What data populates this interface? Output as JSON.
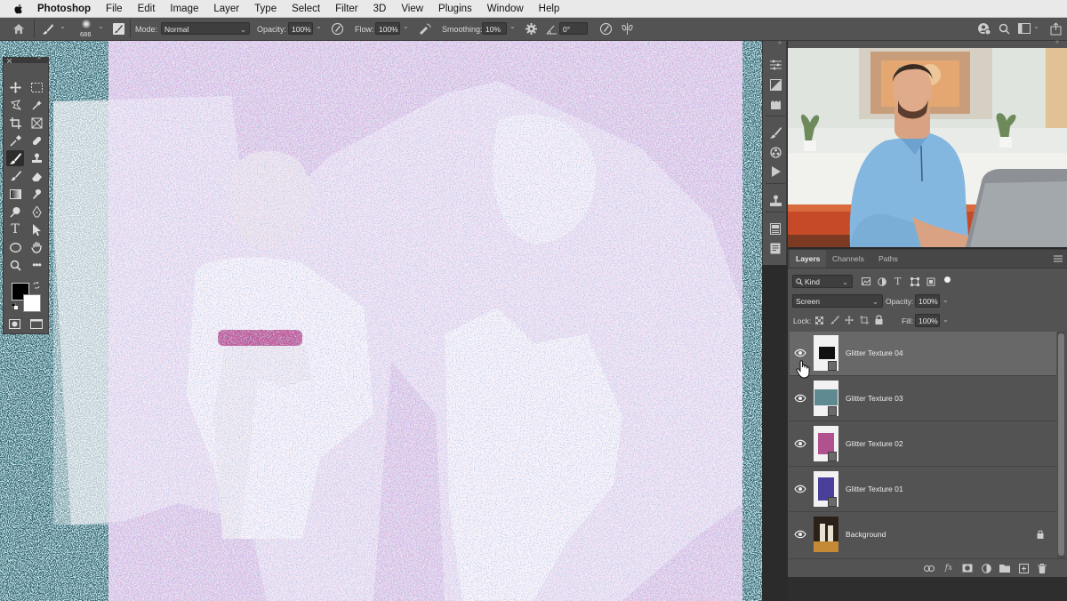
{
  "menubar": {
    "app_name": "Photoshop",
    "items": [
      "File",
      "Edit",
      "Image",
      "Layer",
      "Type",
      "Select",
      "Filter",
      "3D",
      "View",
      "Plugins",
      "Window",
      "Help"
    ]
  },
  "options_bar": {
    "brush_size": "686",
    "mode_label": "Mode:",
    "mode_value": "Normal",
    "opacity_label": "Opacity:",
    "opacity_value": "100%",
    "flow_label": "Flow:",
    "flow_value": "100%",
    "smoothing_label": "Smoothing:",
    "smoothing_value": "10%",
    "angle_value": "0°"
  },
  "layers_panel": {
    "tabs": [
      "Layers",
      "Channels",
      "Paths"
    ],
    "active_tab": "Layers",
    "filter_label": "Kind",
    "blend_mode": "Screen",
    "opacity_label": "Opacity:",
    "opacity_value": "100%",
    "lock_label": "Lock:",
    "fill_label": "Fill:",
    "fill_value": "100%",
    "layers": [
      {
        "name": "Glitter Texture 04",
        "selected": true
      },
      {
        "name": "Glitter Texture 03",
        "selected": false
      },
      {
        "name": "Glitter Texture 02",
        "selected": false
      },
      {
        "name": "Glitter Texture 01",
        "selected": false
      },
      {
        "name": "Background",
        "selected": false
      }
    ]
  },
  "colors": {
    "ui_panel": "#535353",
    "ui_dark": "#3e3e3e",
    "canvas_teal": "#3d6e78",
    "glitter_pink": "#c98fc7"
  }
}
